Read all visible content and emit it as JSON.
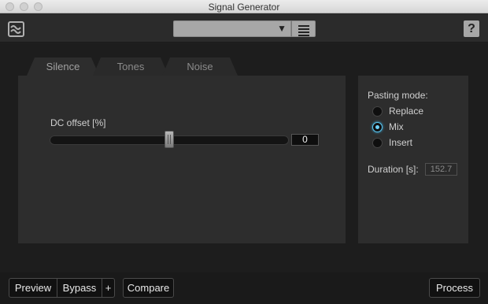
{
  "window": {
    "title": "Signal Generator"
  },
  "header": {
    "logo_icon": "waveform-logo-icon",
    "preset_value": "",
    "preset_arrow": "▼",
    "help_label": "?"
  },
  "tabs": [
    {
      "label": "Silence",
      "active": true
    },
    {
      "label": "Tones",
      "active": false
    },
    {
      "label": "Noise",
      "active": false
    }
  ],
  "silence": {
    "dc_offset_label": "DC offset [%]",
    "dc_offset_value": "0",
    "dc_offset_fraction": 0.5
  },
  "pasting": {
    "title": "Pasting mode:",
    "options": [
      {
        "label": "Replace",
        "checked": false
      },
      {
        "label": "Mix",
        "checked": true
      },
      {
        "label": "Insert",
        "checked": false
      }
    ],
    "selected": "Mix",
    "duration_label": "Duration [s]:",
    "duration_value": "152.7"
  },
  "footer": {
    "preview_label": "Preview",
    "bypass_label": "Bypass",
    "plus_label": "+",
    "compare_label": "Compare",
    "process_label": "Process"
  },
  "colors": {
    "accent": "#5cc7f0",
    "background": "#1d1d1d",
    "panel": "#2d2d2d"
  }
}
